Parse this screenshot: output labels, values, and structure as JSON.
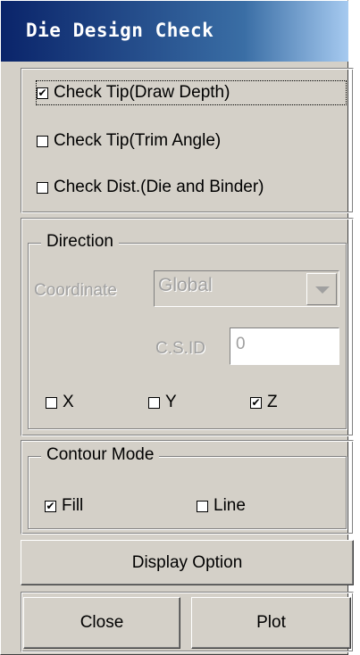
{
  "window": {
    "title": "Die Design Check"
  },
  "checks": {
    "draw_depth": {
      "label": "Check Tip(Draw Depth)",
      "checked": true
    },
    "trim_angle": {
      "label": "Check Tip(Trim Angle)",
      "checked": false
    },
    "die_binder": {
      "label": "Check Dist.(Die and Binder)",
      "checked": false
    }
  },
  "direction": {
    "legend": "Direction",
    "coordinate_label": "Coordinate",
    "coordinate_value": "Global",
    "csid_label": "C.S.ID",
    "csid_value": "0",
    "axes": [
      {
        "label": "X",
        "checked": false
      },
      {
        "label": "Y",
        "checked": false
      },
      {
        "label": "Z",
        "checked": true
      }
    ]
  },
  "contour": {
    "legend": "Contour Mode",
    "fill": {
      "label": "Fill",
      "checked": true
    },
    "line": {
      "label": "Line",
      "checked": false
    }
  },
  "buttons": {
    "display_option": "Display Option",
    "close": "Close",
    "plot": "Plot"
  }
}
